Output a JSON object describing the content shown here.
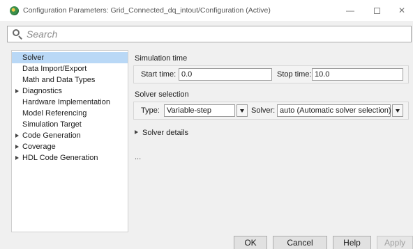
{
  "window": {
    "title": "Configuration Parameters: Grid_Connected_dq_intout/Configuration (Active)",
    "controls": {
      "minimize": "—",
      "maximize": "□",
      "close": "✕"
    }
  },
  "search": {
    "placeholder": "Search",
    "value": ""
  },
  "tree": {
    "items": [
      {
        "label": "Solver",
        "expandable": false,
        "selected": true
      },
      {
        "label": "Data Import/Export",
        "expandable": false
      },
      {
        "label": "Math and Data Types",
        "expandable": false
      },
      {
        "label": "Diagnostics",
        "expandable": true
      },
      {
        "label": "Hardware Implementation",
        "expandable": false
      },
      {
        "label": "Model Referencing",
        "expandable": false
      },
      {
        "label": "Simulation Target",
        "expandable": false
      },
      {
        "label": "Code Generation",
        "expandable": true
      },
      {
        "label": "Coverage",
        "expandable": true
      },
      {
        "label": "HDL Code Generation",
        "expandable": true
      }
    ]
  },
  "simulation_time": {
    "heading": "Simulation time",
    "start_label": "Start time:",
    "start_value": "0.0",
    "stop_label": "Stop time:",
    "stop_value": "10.0"
  },
  "solver_selection": {
    "heading": "Solver selection",
    "type_label": "Type:",
    "type_value": "Variable-step",
    "solver_label": "Solver:",
    "solver_value": "auto (Automatic solver selection)"
  },
  "solver_details": {
    "label": "Solver details"
  },
  "ellipsis": "...",
  "footer": {
    "ok": "OK",
    "cancel": "Cancel",
    "help": "Help",
    "apply": "Apply"
  },
  "colors": {
    "selection": "#b9d8f6",
    "background": "#f0f0f0"
  }
}
